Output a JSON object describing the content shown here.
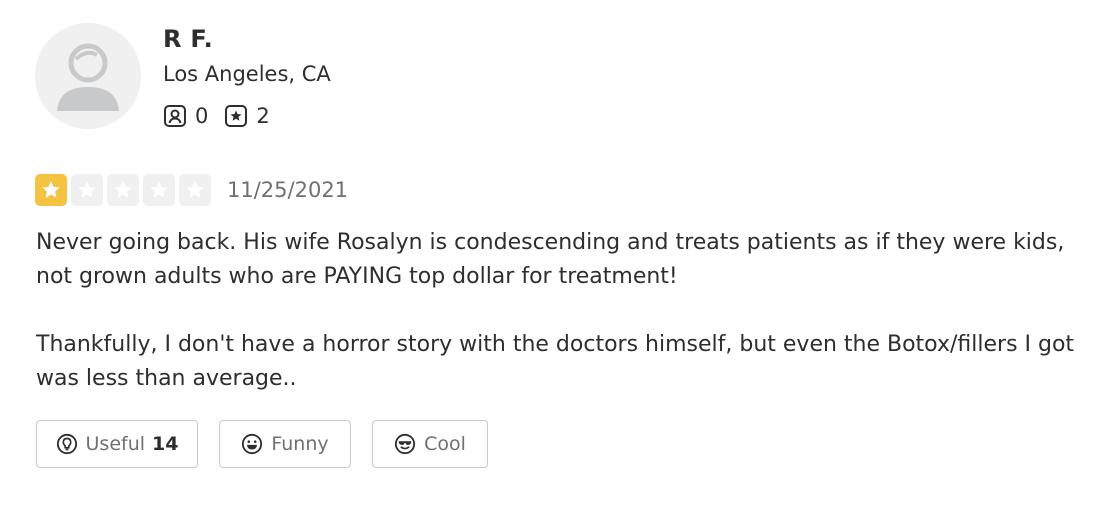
{
  "user": {
    "name": "R F.",
    "location": "Los Angeles, CA",
    "stats": {
      "friends_icon": "friends-icon",
      "friends_count": "0",
      "reviews_icon": "star-review-icon",
      "reviews_count": "2"
    },
    "avatar_icon": "default-avatar-icon"
  },
  "review": {
    "rating": 1,
    "rating_max": 5,
    "date": "11/25/2021",
    "paragraphs": [
      "Never going back. His wife Rosalyn is condescending and treats patients as if they were kids, not grown adults who are PAYING top dollar for treatment!",
      "Thankfully, I don't have a horror story with the doctors himself, but even the Botox/fillers I got was less than average.."
    ]
  },
  "reactions": {
    "useful": {
      "label": "Useful",
      "count": "14",
      "icon": "lightbulb-icon"
    },
    "funny": {
      "label": "Funny",
      "icon": "smile-icon"
    },
    "cool": {
      "label": "Cool",
      "icon": "sunglasses-icon"
    }
  },
  "colors": {
    "star_filled": "#f5c342",
    "star_empty": "#f0f0f0",
    "text": "#2d2e2f",
    "muted": "#6e7072",
    "border": "#c8c9ca"
  }
}
